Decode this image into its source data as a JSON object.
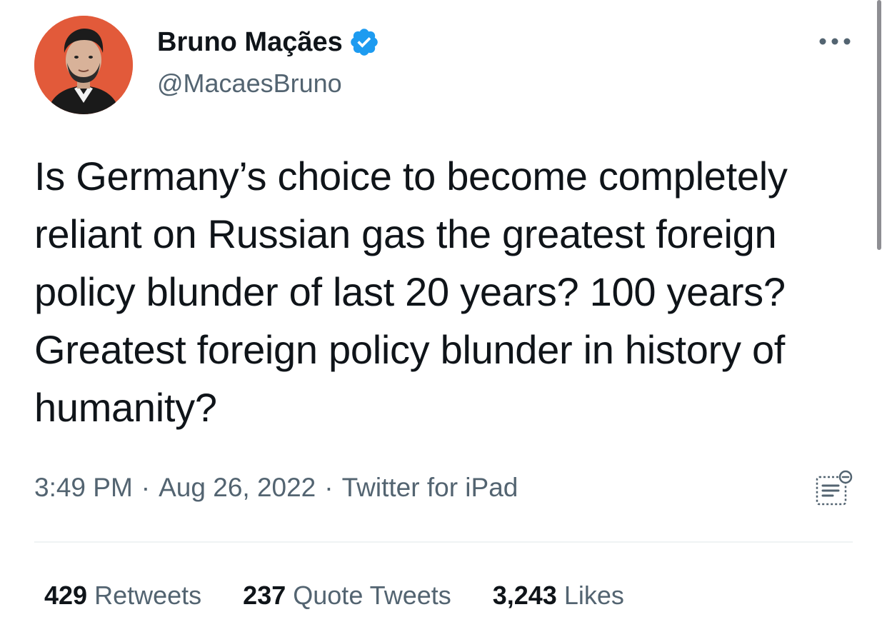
{
  "author": {
    "display_name": "Bruno Maçães",
    "handle": "@MacaesBruno",
    "verified": true
  },
  "tweet": {
    "text": "Is Germany’s choice to become completely reliant on Russian gas the greatest foreign policy blunder of last 20 years? 100 years? Greatest foreign policy blunder in history of humanity?",
    "time": "3:49 PM",
    "separator": "·",
    "date": "Aug 26, 2022",
    "source": "Twitter for iPad"
  },
  "stats": {
    "retweets": {
      "count": "429",
      "label": "Retweets"
    },
    "quote_tweets": {
      "count": "237",
      "label": "Quote Tweets"
    },
    "likes": {
      "count": "3,243",
      "label": "Likes"
    }
  },
  "colors": {
    "verified_blue": "#1d9bf0",
    "avatar_bg": "#e25a3a",
    "secondary_text": "#536471",
    "primary_text": "#0f1419",
    "divider": "#eff3f4"
  },
  "icons": {
    "more": "more-horizontal-icon",
    "verified": "verified-badge-icon",
    "translate": "view-edit-history-icon"
  }
}
